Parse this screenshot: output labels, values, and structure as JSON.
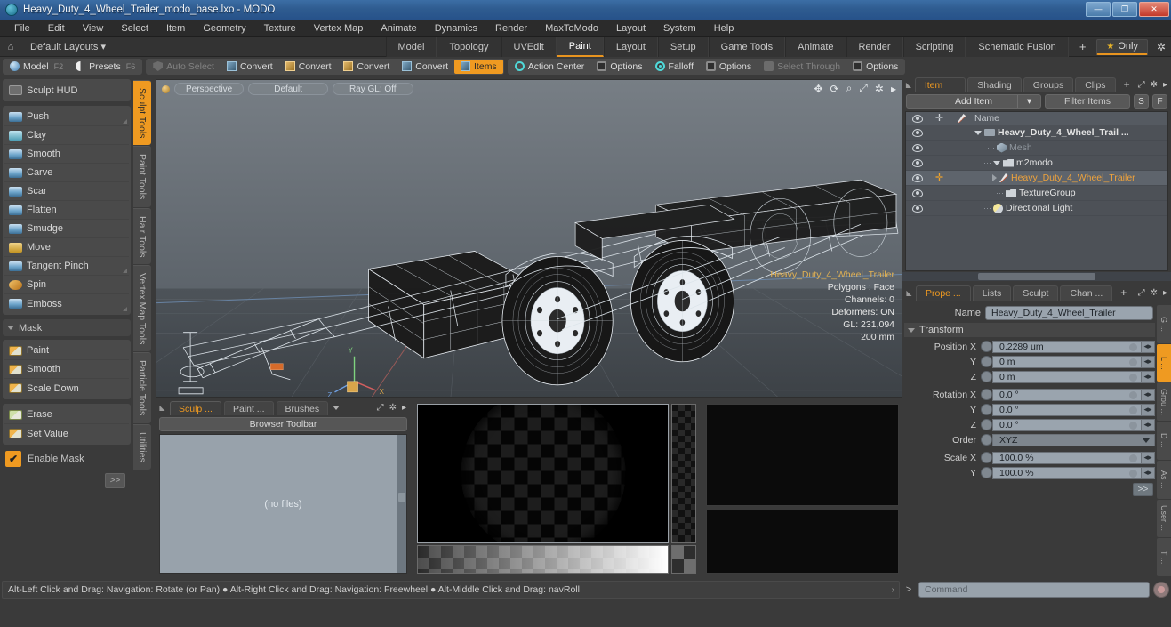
{
  "window": {
    "title": "Heavy_Duty_4_Wheel_Trailer_modo_base.lxo - MODO",
    "app_icon": "modo-icon",
    "minimize": "—",
    "maximize": "❐",
    "close": "✕"
  },
  "menubar": {
    "items": [
      "File",
      "Edit",
      "View",
      "Select",
      "Item",
      "Geometry",
      "Texture",
      "Vertex Map",
      "Animate",
      "Dynamics",
      "Render",
      "MaxToModo",
      "Layout",
      "System",
      "Help"
    ]
  },
  "layoutbar": {
    "home_icon": "home-icon",
    "layout_name": "Default Layouts",
    "tabs": [
      "Model",
      "Topology",
      "UVEdit",
      "Paint",
      "Layout",
      "Setup",
      "Game Tools",
      "Animate",
      "Render",
      "Scripting",
      "Schematic Fusion"
    ],
    "active_tab": "Paint",
    "plus": "+",
    "only_label": "Only",
    "star_icon": "star-icon",
    "gear_icon": "gear-icon"
  },
  "modebar": {
    "group1": [
      {
        "label": "Model",
        "key": "F2",
        "icon": "sphere-icon",
        "state": "normal"
      },
      {
        "label": "Presets",
        "key": "F6",
        "icon": "presets-icon",
        "state": "normal"
      }
    ],
    "group2": [
      {
        "label": "Auto Select",
        "icon": "shield-icon",
        "state": "dim"
      },
      {
        "label": "Convert",
        "icon": "vertex-cube-icon",
        "state": "normal"
      },
      {
        "label": "Convert",
        "icon": "edge-cube-icon",
        "state": "normal"
      },
      {
        "label": "Convert",
        "icon": "poly-cube-icon",
        "state": "normal"
      },
      {
        "label": "Convert",
        "icon": "material-cube-icon",
        "state": "normal"
      },
      {
        "label": "Items",
        "icon": "item-cube-icon",
        "state": "active"
      }
    ],
    "group3": [
      {
        "label": "Action Center",
        "icon": "action-center-icon",
        "state": "normal"
      },
      {
        "label": "Options",
        "icon": "options-square-icon",
        "state": "normal"
      },
      {
        "label": "Falloff",
        "icon": "falloff-icon",
        "state": "normal"
      },
      {
        "label": "Options",
        "icon": "options-square-icon",
        "state": "normal"
      },
      {
        "label": "Select Through",
        "icon": "select-through-icon",
        "state": "dim"
      },
      {
        "label": "Options",
        "icon": "options-square-icon",
        "state": "normal"
      }
    ]
  },
  "sculpt_panel": {
    "hud_label": "Sculpt HUD",
    "hud_icon": "hud-icon",
    "tools": [
      {
        "label": "Push",
        "icon": "push-brush-icon",
        "corner": true
      },
      {
        "label": "Clay",
        "icon": "clay-brush-icon",
        "corner": false
      },
      {
        "label": "Smooth",
        "icon": "smooth-brush-icon",
        "corner": false
      },
      {
        "label": "Carve",
        "icon": "carve-brush-icon",
        "corner": false
      },
      {
        "label": "Scar",
        "icon": "scar-brush-icon",
        "corner": false
      },
      {
        "label": "Flatten",
        "icon": "flatten-brush-icon",
        "corner": false
      },
      {
        "label": "Smudge",
        "icon": "smudge-brush-icon",
        "corner": false
      },
      {
        "label": "Move",
        "icon": "move-brush-icon",
        "corner": false
      },
      {
        "label": "Tangent Pinch",
        "icon": "pinch-brush-icon",
        "corner": true
      },
      {
        "label": "Spin",
        "icon": "spin-brush-icon",
        "corner": false
      },
      {
        "label": "Emboss",
        "icon": "emboss-brush-icon",
        "corner": true
      }
    ],
    "mask_section": "Mask",
    "mask_tools": [
      {
        "label": "Paint",
        "icon": "mask-paint-icon"
      },
      {
        "label": "Smooth",
        "icon": "mask-smooth-icon"
      },
      {
        "label": "Scale Down",
        "icon": "mask-scale-icon"
      }
    ],
    "mask_tools2": [
      {
        "label": "Erase",
        "icon": "mask-erase-icon"
      },
      {
        "label": "Set Value",
        "icon": "mask-setvalue-icon"
      }
    ],
    "enable_mask": {
      "label": "Enable Mask",
      "checked": true,
      "check_glyph": "✔"
    },
    "more_label": ">>"
  },
  "left_vtabs": {
    "items": [
      "Sculpt Tools",
      "Paint Tools",
      "Hair Tools",
      "Vertex Map Tools",
      "Particle Tools",
      "Utilities"
    ],
    "active": "Sculpt Tools"
  },
  "viewport": {
    "view_mode": "Perspective",
    "shading": "Default",
    "raygl": "Ray GL: Off",
    "nav_icons": [
      "pan-icon",
      "rotate-icon",
      "zoom-icon",
      "fit-icon",
      "viewport-gear-icon",
      "viewport-arrow-icon"
    ],
    "info": {
      "mesh_name": "Heavy_Duty_4_Wheel_Trailer",
      "polygons": "Polygons : Face",
      "channels": "Channels: 0",
      "deformers": "Deformers: ON",
      "gl": "GL: 231,094",
      "scale": "200 mm"
    },
    "axis_labels": {
      "x": "X",
      "y": "Y",
      "z": "Z"
    }
  },
  "browser": {
    "tabs": [
      "Sculp ...",
      "Paint ...",
      "Brushes"
    ],
    "active_tab": "Sculp ...",
    "caret_icon": "chevron-down-icon",
    "expand_icon": "expand-icon",
    "gear_icon": "gear-icon",
    "arrow_icon": "chevron-right-icon",
    "toolbar_label": "Browser Toolbar",
    "empty_text": "(no files)"
  },
  "itemlist": {
    "tabs": [
      "Item List",
      "Shading",
      "Groups",
      "Clips"
    ],
    "active_tab": "Item List",
    "plus": "+",
    "add_item": "Add Item",
    "filter_placeholder": "Filter Items",
    "btn_s": "S",
    "btn_f": "F",
    "columns": [
      "eye-column",
      "transform-column",
      "deform-column",
      "Name"
    ],
    "name_header": "Name",
    "rows": [
      {
        "name": "Heavy_Duty_4_Wheel_Trail ...",
        "icon": "scene-icon",
        "indent": 0,
        "expanded": true,
        "selected": false,
        "dim": false,
        "bold": true
      },
      {
        "name": "Mesh",
        "icon": "mesh-icon",
        "indent": 1,
        "expanded": false,
        "selected": false,
        "dim": true,
        "bold": false
      },
      {
        "name": "m2modo",
        "icon": "folder-icon",
        "indent": 1,
        "expanded": true,
        "selected": false,
        "dim": false,
        "bold": false
      },
      {
        "name": "Heavy_Duty_4_Wheel_Trailer",
        "icon": "material-icon",
        "indent": 2,
        "expanded": false,
        "selected": true,
        "dim": false,
        "bold": false
      },
      {
        "name": "TextureGroup",
        "icon": "folder-icon",
        "indent": 2,
        "expanded": false,
        "selected": false,
        "dim": false,
        "bold": false
      },
      {
        "name": "Directional Light",
        "icon": "light-icon",
        "indent": 1,
        "expanded": false,
        "selected": false,
        "dim": false,
        "bold": false
      }
    ]
  },
  "properties": {
    "tabs": [
      "Prope ...",
      "Lists",
      "Sculpt",
      "Chan ..."
    ],
    "active_tab": "Prope ...",
    "plus": "+",
    "name_label": "Name",
    "name_value": "Heavy_Duty_4_Wheel_Trailer",
    "transform_label": "Transform",
    "fields": [
      {
        "label": "Position X",
        "value": "0.2289 um",
        "type": "number"
      },
      {
        "label": "Y",
        "value": "0 m",
        "type": "number"
      },
      {
        "label": "Z",
        "value": "0 m",
        "type": "number"
      },
      {
        "label": "Rotation X",
        "value": "0.0 °",
        "type": "number"
      },
      {
        "label": "Y",
        "value": "0.0 °",
        "type": "number"
      },
      {
        "label": "Z",
        "value": "0.0 °",
        "type": "number"
      },
      {
        "label": "Order",
        "value": "XYZ",
        "type": "select"
      },
      {
        "label": "Scale X",
        "value": "100.0 %",
        "type": "number"
      },
      {
        "label": "Y",
        "value": "100.0 %",
        "type": "number"
      }
    ],
    "more_label": ">>",
    "vtabs": [
      "G ...",
      "L ...",
      "Grou ...",
      "D ...",
      "As ...",
      "User ...",
      "T ..."
    ],
    "vtabs_active": "L ..."
  },
  "statusbar": {
    "message": "Alt-Left Click and Drag: Navigation: Rotate (or Pan) ● Alt-Right Click and Drag: Navigation: Freewheel ● Alt-Middle Click and Drag: navRoll",
    "chevron": "›",
    "cmd_prefix": ">",
    "cmd_placeholder": "Command",
    "record_icon": "record-icon"
  },
  "colors": {
    "accent": "#ef9a21",
    "titlebar": "#2f5c90",
    "panel": "#3a3a3a",
    "field": "#9aa4ae"
  }
}
